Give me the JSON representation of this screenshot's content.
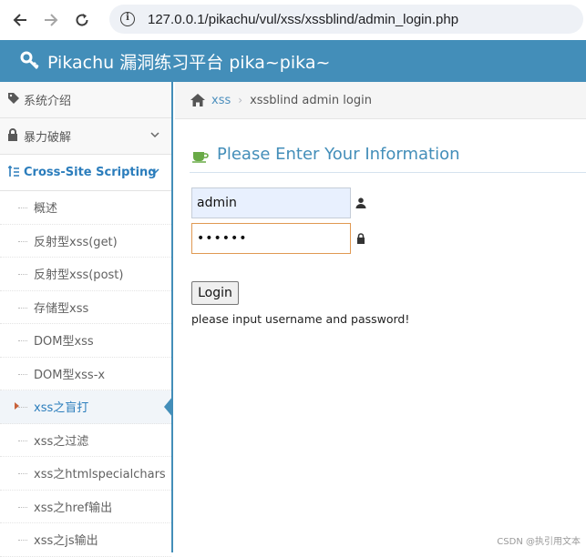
{
  "browser": {
    "url": "127.0.0.1/pikachu/vul/xss/xssblind/admin_login.php",
    "back_icon": "back-arrow-icon",
    "forward_icon": "forward-arrow-icon",
    "reload_icon": "reload-icon",
    "info_icon": "info-icon"
  },
  "header": {
    "title": "Pikachu 漏洞练习平台 pika~pika~",
    "bg_color": "#438eb9"
  },
  "sidebar": {
    "sections": [
      {
        "label": "系统介绍",
        "icon": "tag-icon"
      },
      {
        "label": "暴力破解",
        "icon": "lock-icon"
      },
      {
        "label": "Cross-Site Scripting",
        "icon": "xss-list-icon"
      }
    ],
    "xss_items": [
      "概述",
      "反射型xss(get)",
      "反射型xss(post)",
      "存储型xss",
      "DOM型xss",
      "DOM型xss-x",
      "xss之盲打",
      "xss之过滤",
      "xss之htmlspecialchars",
      "xss之href输出",
      "xss之js输出"
    ],
    "current_index": 6
  },
  "breadcrumb": {
    "link": "xss",
    "current": "xssblind admin login"
  },
  "form": {
    "heading": "Please Enter Your Information",
    "username_value": "admin",
    "password_value": "••••••",
    "login_label": "Login",
    "hint": "please input username and password!"
  },
  "watermark": "CSDN @执引用文本",
  "colors": {
    "accent": "#438eb9",
    "link": "#2b7dbc",
    "caret": "#c86139"
  }
}
